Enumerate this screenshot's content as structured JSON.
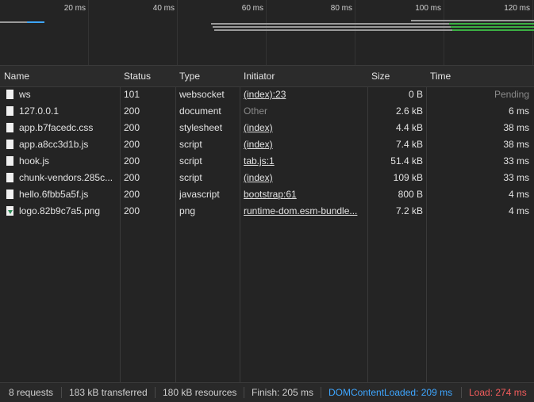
{
  "timeline": {
    "ticks": [
      "20 ms",
      "40 ms",
      "60 ms",
      "80 ms",
      "100 ms",
      "120 ms"
    ]
  },
  "columns": {
    "name": "Name",
    "status": "Status",
    "type": "Type",
    "initiator": "Initiator",
    "size": "Size",
    "time": "Time"
  },
  "requests": [
    {
      "name": "ws",
      "status": "101",
      "type": "websocket",
      "initiator": "(index):23",
      "initiator_link": true,
      "size": "0 B",
      "time": "Pending",
      "time_muted": true,
      "icon": "document-icon"
    },
    {
      "name": "127.0.0.1",
      "status": "200",
      "type": "document",
      "initiator": "Other",
      "initiator_link": false,
      "size": "2.6 kB",
      "time": "6 ms",
      "time_muted": false,
      "icon": "document-icon"
    },
    {
      "name": "app.b7facedc.css",
      "status": "200",
      "type": "stylesheet",
      "initiator": "(index)",
      "initiator_link": true,
      "size": "4.4 kB",
      "time": "38 ms",
      "time_muted": false,
      "icon": "document-icon"
    },
    {
      "name": "app.a8cc3d1b.js",
      "status": "200",
      "type": "script",
      "initiator": "(index)",
      "initiator_link": true,
      "size": "7.4 kB",
      "time": "38 ms",
      "time_muted": false,
      "icon": "document-icon"
    },
    {
      "name": "hook.js",
      "status": "200",
      "type": "script",
      "initiator": "tab.js:1",
      "initiator_link": true,
      "size": "51.4 kB",
      "time": "33 ms",
      "time_muted": false,
      "icon": "document-icon"
    },
    {
      "name": "chunk-vendors.285c...",
      "status": "200",
      "type": "script",
      "initiator": "(index)",
      "initiator_link": true,
      "size": "109 kB",
      "time": "33 ms",
      "time_muted": false,
      "icon": "document-icon"
    },
    {
      "name": "hello.6fbb5a5f.js",
      "status": "200",
      "type": "javascript",
      "initiator": "bootstrap:61",
      "initiator_link": true,
      "size": "800 B",
      "time": "4 ms",
      "time_muted": false,
      "icon": "document-icon"
    },
    {
      "name": "logo.82b9c7a5.png",
      "status": "200",
      "type": "png",
      "initiator": "runtime-dom.esm-bundle...",
      "initiator_link": true,
      "size": "7.2 kB",
      "time": "4 ms",
      "time_muted": false,
      "icon": "image-icon"
    }
  ],
  "status_bar": {
    "requests": "8 requests",
    "transferred": "183 kB transferred",
    "resources": "180 kB resources",
    "finish": "Finish: 205 ms",
    "dom_content_loaded": "DOMContentLoaded: 209 ms",
    "load": "Load: 274 ms",
    "dom_color": "#3ea6ff",
    "load_color": "#f45c5c"
  }
}
